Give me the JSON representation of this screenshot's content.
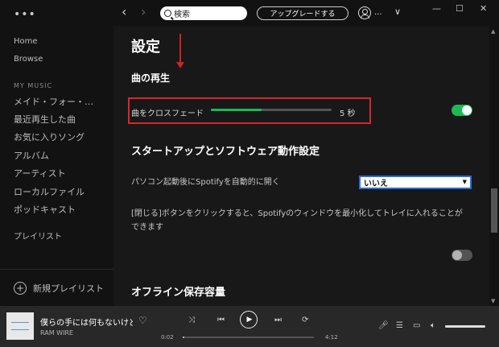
{
  "sidebar": {
    "menu_glyph": "•••",
    "nav": [
      "Home",
      "Browse"
    ],
    "section_title": "MY MUSIC",
    "library": [
      "メイド・フォー・…",
      "最近再生した曲",
      "お気に入りソング",
      "アルバム",
      "アーティスト",
      "ローカルファイル",
      "ポッドキャスト"
    ],
    "playlists_label": "プレイリスト",
    "new_playlist": "新規プレイリスト"
  },
  "topbar": {
    "back_glyph": "‹",
    "forward_glyph": "›",
    "search_text": "検索",
    "upgrade": "アップグレードする",
    "user_name": "...",
    "chevron": "∨",
    "minimize": "—",
    "maximize": "☐",
    "close": "✕"
  },
  "settings": {
    "title": "設定",
    "playback_heading": "曲の再生",
    "crossfade_label": "曲をクロスフェード",
    "crossfade_value": "5 秒",
    "crossfade_fraction": 0.42,
    "crossfade_toggle_on": true,
    "startup_heading": "スタートアップとソフトウェア動作設定",
    "autostart_label": "パソコン起動後にSpotifyを自動的に開く",
    "autostart_value": "いいえ",
    "close_button_text_1": "[閉じる]ボタンをクリックすると、Spotifyのウィンドウを最小化してトレイに入れることが",
    "close_button_text_2": "できます",
    "minimize_to_tray_toggle_on": false,
    "offline_heading": "オフライン保存容量"
  },
  "player": {
    "song": "僕らの手には何もないけど",
    "artist": "RAM WIRE",
    "elapsed": "0:02",
    "duration": "4:12",
    "progress_fraction": 0.01,
    "volume_fraction": 1.0,
    "icons": [
      "heart-icon",
      "shuffle-icon",
      "previous-icon",
      "play-icon",
      "next-icon",
      "repeat-icon",
      "lyrics-icon",
      "queue-icon",
      "devices-icon",
      "volume-icon"
    ]
  },
  "colors": {
    "accent": "#1db954",
    "highlight_box": "#d8262d",
    "select_border": "#2b6cd6"
  }
}
